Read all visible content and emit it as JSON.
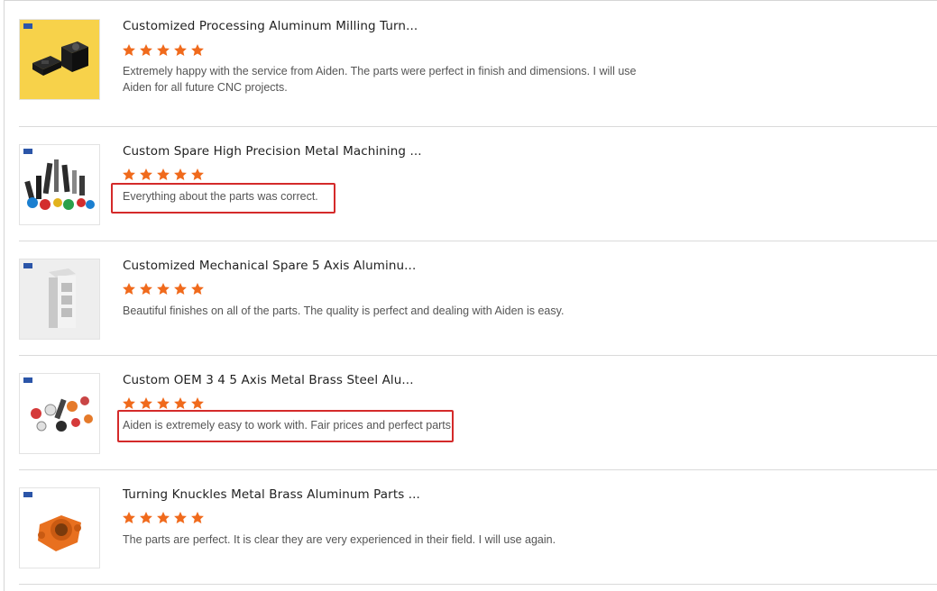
{
  "reviews": [
    {
      "title": "Customized Processing Aluminum Milling Turn...",
      "rating": 5,
      "comment": "Extremely happy with the service from Aiden. The parts were perfect in finish and dimensions. I will use Aiden for all future CNC projects.",
      "highlighted": false
    },
    {
      "title": "Custom Spare High Precision Metal Machining ...",
      "rating": 5,
      "comment": "Everything about the parts was correct.",
      "highlighted": true
    },
    {
      "title": "Customized Mechanical Spare 5 Axis Aluminu...",
      "rating": 5,
      "comment": "Beautiful finishes on all of the parts. The quality is perfect and dealing with Aiden is easy.",
      "highlighted": false
    },
    {
      "title": "Custom OEM 3 4 5 Axis Metal Brass Steel Alu...",
      "rating": 5,
      "comment": "Aiden is extremely easy to work with. Fair prices and perfect parts.",
      "highlighted": true
    },
    {
      "title": "Turning Knuckles Metal Brass Aluminum Parts ...",
      "rating": 5,
      "comment": "The parts are perfect. It is clear they are very experienced in their field. I will use again.",
      "highlighted": false
    }
  ],
  "colors": {
    "star": "#f06a1c",
    "highlight_border": "#d42a2a",
    "separator": "#dadada"
  }
}
